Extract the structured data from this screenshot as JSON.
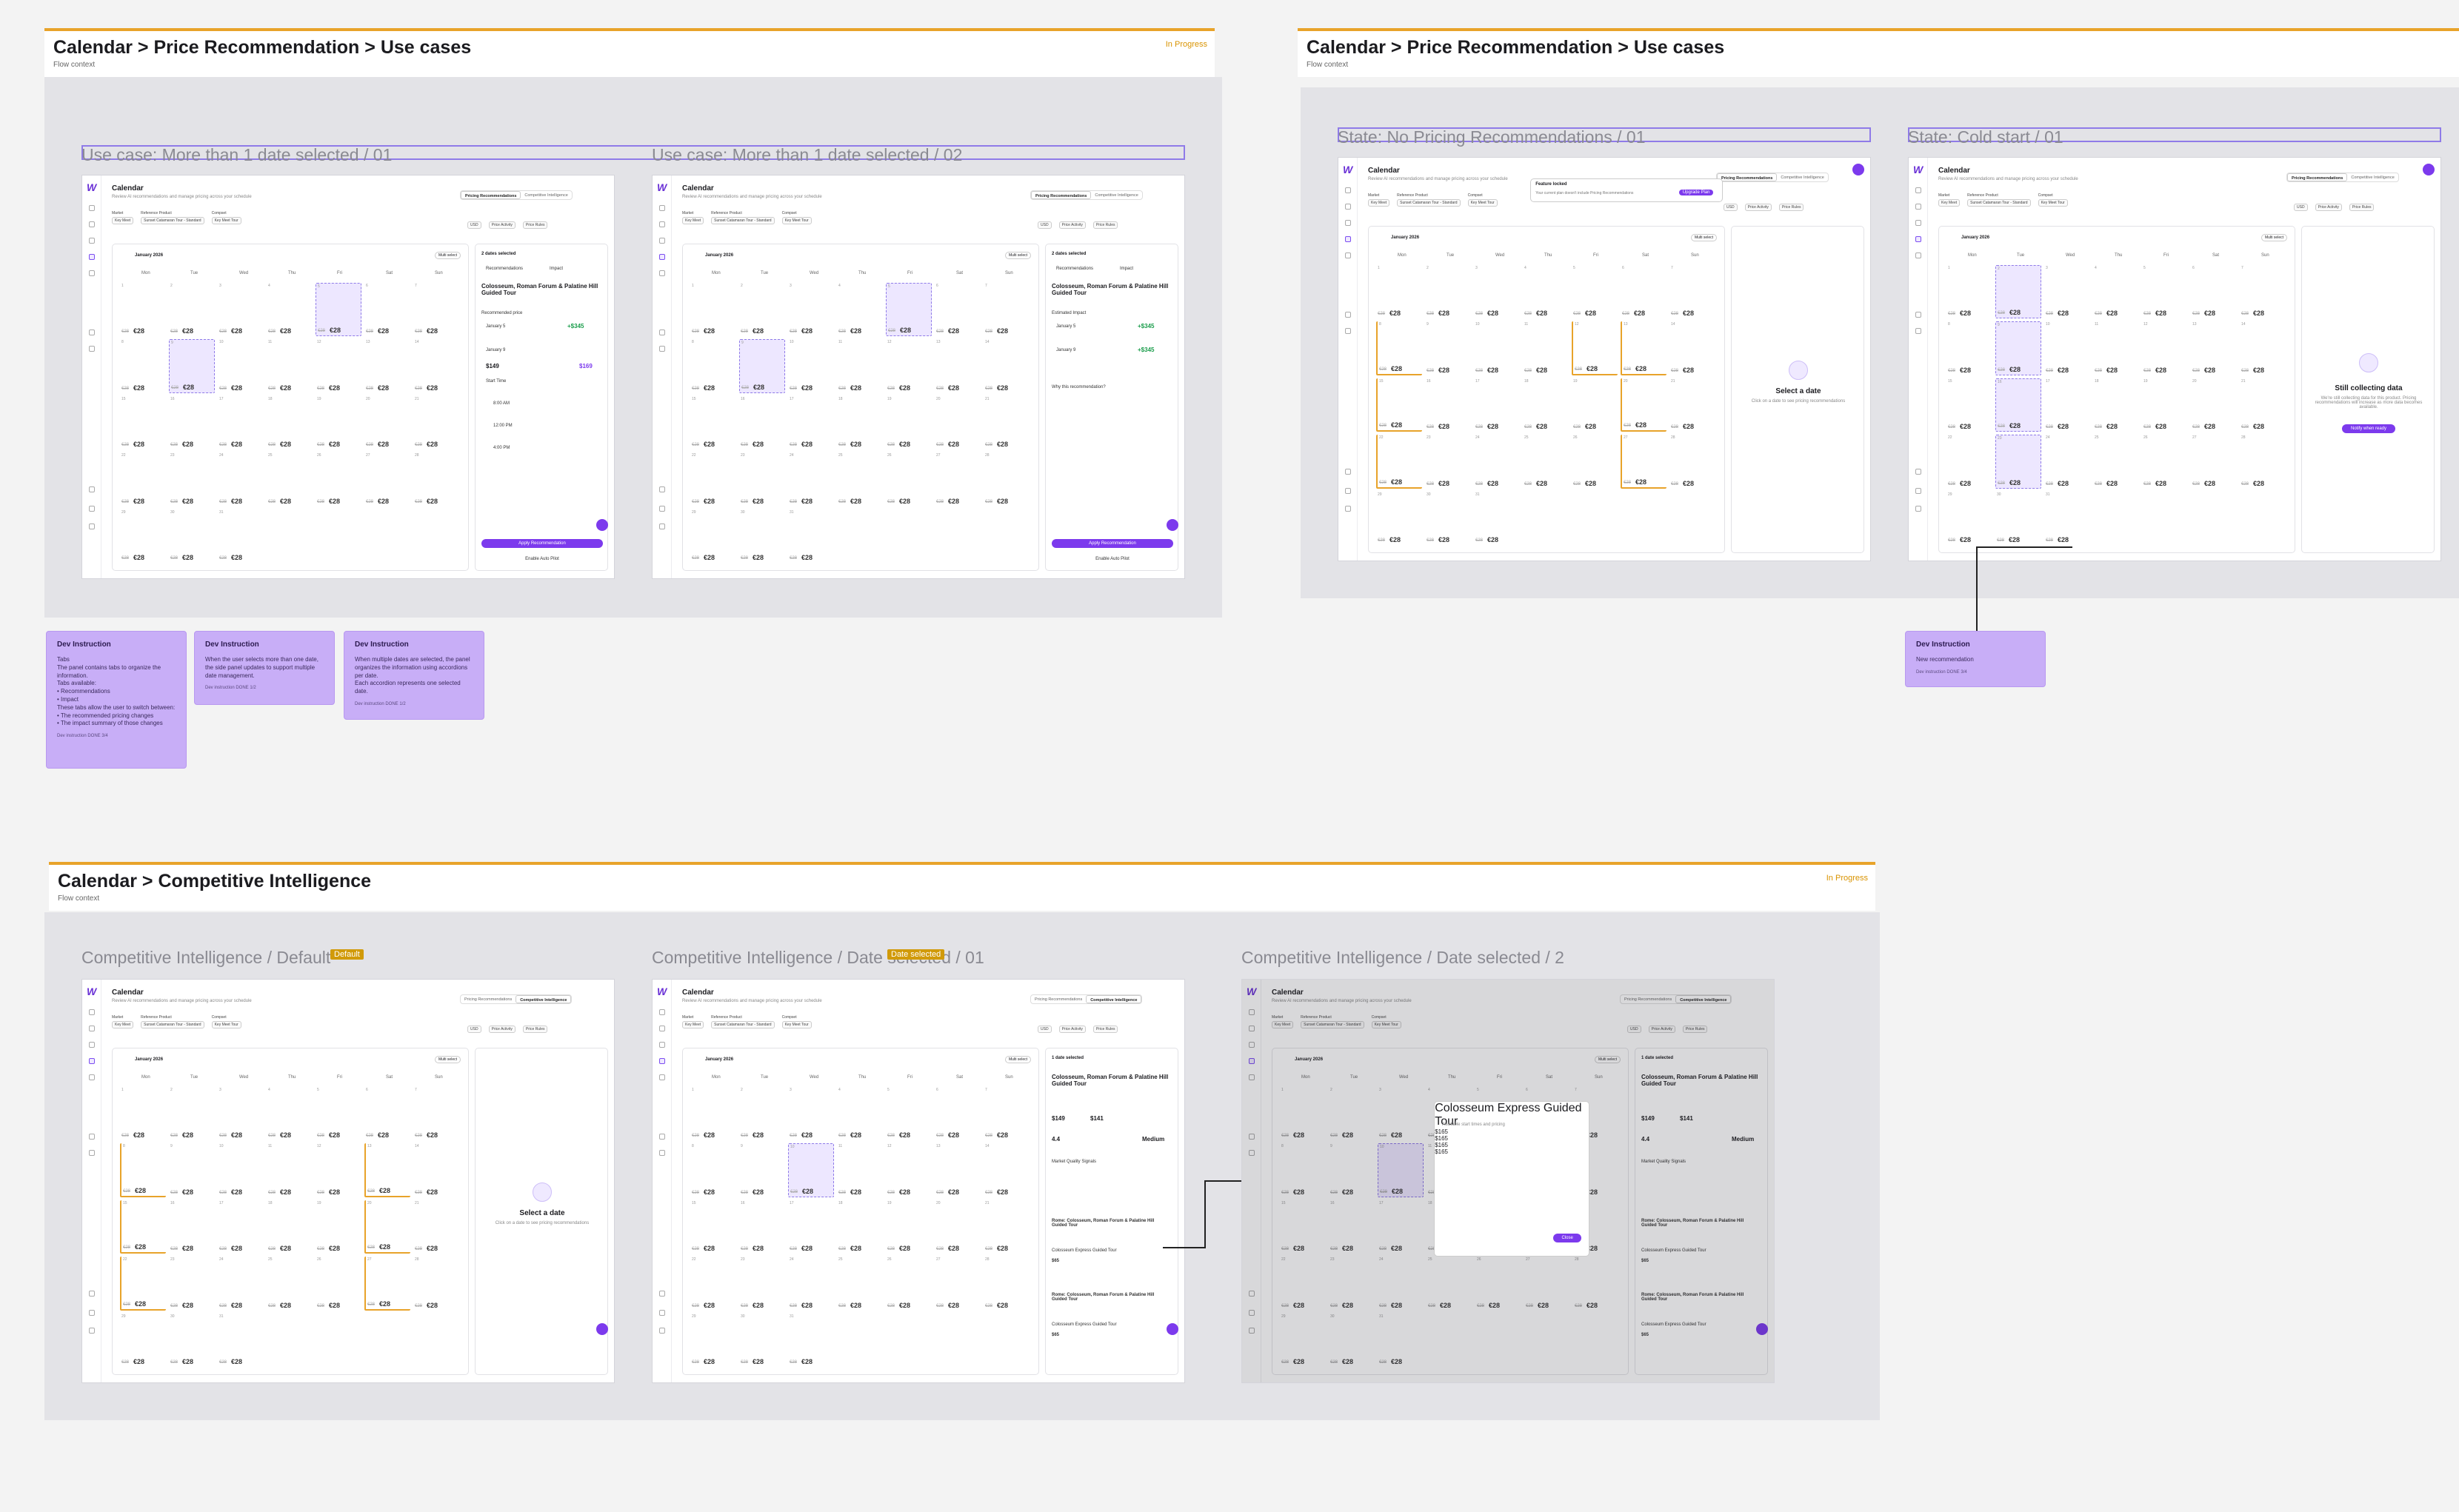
{
  "sections": {
    "s1": {
      "title": "Calendar > Price Recommendation > Use cases",
      "subtitle": "Flow context",
      "status": "In Progress"
    },
    "s2": {
      "title": "Calendar > Price Recommendation > Use cases",
      "subtitle": "Flow context",
      "status": ""
    },
    "s3": {
      "title": "Calendar > Competitive Intelligence",
      "subtitle": "Flow context",
      "status": "In Progress"
    }
  },
  "frames": {
    "f1": "Use case: More than 1 date selected / 01",
    "f2": "Use case: More than 1 date selected / 02",
    "f3": "State: No Pricing Recommendations / 01",
    "f4": "State: Cold start / 01",
    "f5": "Competitive Intelligence / Default",
    "f6": "Competitive Intelligence / Date selected / 01",
    "f7": "Competitive Intelligence / Date selected / 2"
  },
  "tags": {
    "t5": "Default",
    "t6": "Date selected"
  },
  "app": {
    "title": "Calendar",
    "subtitle": "Review AI recommendations and manage pricing across your schedule",
    "tab_pricing": "Pricing Recommendations",
    "tab_ci": "Competitive Intelligence",
    "filter_market": "Market",
    "filter_market_value": "Key Meet",
    "filter_ref": "Reference Product",
    "filter_ref_value": "Sunset Catamaran Tour - Standard",
    "filter_compset": "Compset",
    "filter_compset_value": "Key Meet Tour",
    "currency": "USD",
    "price_activity": "Price Activity",
    "price_rules": "Price Rules",
    "month": "January 2026",
    "multi_select": "Multi select",
    "days": [
      "Mon",
      "Tue",
      "Wed",
      "Thu",
      "Fri",
      "Sat",
      "Sun"
    ],
    "old_price": "€28",
    "new_price": "€28"
  },
  "panel": {
    "dates_selected": "2 dates selected",
    "one_date_selected": "1 date selected",
    "tab_recs": "Recommendations",
    "tab_impact": "Impact",
    "product": "Colosseum, Roman Forum & Palatine Hill Guided Tour",
    "rec_price": "Recommended price",
    "jan5": "January 5",
    "jan9": "January 9",
    "uplift": "+$345",
    "current": "$149",
    "recommended": "$169",
    "start_time": "Start Time",
    "times": [
      "8:00 AM",
      "12:00 PM",
      "4:00 PM"
    ],
    "apply": "Apply Recommendation",
    "autopilot": "Enable Auto Pilot",
    "estimated_impact": "Estimated Impact",
    "why": "Why this recommendation?",
    "select_date": "Select a date",
    "select_date_sub": "Click on a date to see pricing recommendations",
    "still_collecting": "Still collecting data",
    "still_collecting_sub": "We're still collecting data for this product. Pricing recommendations will increase as more data becomes available.",
    "notify": "Notify when ready",
    "feature_locked": "Feature locked",
    "feature_locked_sub": "Your current plan doesn't include Pricing Recommendations",
    "upgrade": "Upgrade Plan",
    "market_quality": "Market Quality Signals",
    "price_a": "$149",
    "price_b": "$141",
    "rating": "4.4",
    "medium": "Medium",
    "rome_product": "Rome: Colosseum, Roman Forum & Palatine Hill Guided Tour",
    "comp_product": "Colosseum Express Guided Tour",
    "comp_price": "$65"
  },
  "modal": {
    "title": "Colosseum Express Guided Tour",
    "sub": "Available start times and pricing",
    "rows": [
      "$165",
      "$165",
      "$165",
      "$165"
    ],
    "close": "Close"
  },
  "devs": {
    "d1": {
      "title": "Dev Instruction",
      "body": "Tabs\nThe panel contains tabs to organize the information.\nTabs available:\n • Recommendations\n • Impact\nThese tabs allow the user to switch between:\n • The recommended pricing changes\n • The impact summary of those changes",
      "foot": "Dev instruction  DONE 3/4"
    },
    "d2": {
      "title": "Dev Instruction",
      "body": "When the user selects more than one date, the side panel updates to support multiple date management.",
      "foot": "Dev instruction  DONE 1/2"
    },
    "d3": {
      "title": "Dev Instruction",
      "body": "When multiple dates are selected, the panel organizes the information using accordions per date.\nEach accordion represents one selected date.",
      "foot": "Dev instruction  DONE 1/2"
    },
    "d4": {
      "title": "Dev Instruction",
      "body": "New recommendation",
      "foot": "Dev instruction  DONE 3/4"
    }
  },
  "colors": {
    "accent": "#7c3aed",
    "status": "#e8a32a",
    "dev_note": "#c8aef7"
  }
}
